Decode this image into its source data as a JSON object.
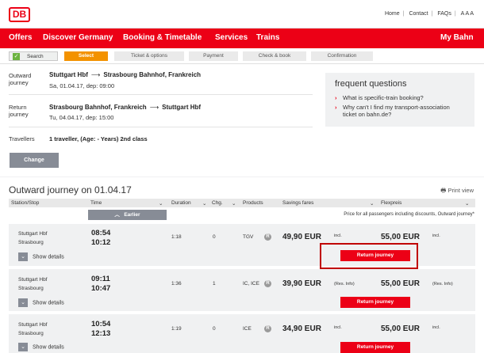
{
  "brand": {
    "logo": "DB",
    "primary_color": "#ec0016",
    "accent_color": "#f39200"
  },
  "top_links": {
    "home": "Home",
    "contact": "Contact",
    "faqs": "FAQs",
    "font_size": "A A A"
  },
  "nav": {
    "offers": "Offers",
    "discover": "Discover Germany",
    "booking": "Booking & Timetable",
    "services": "Services",
    "trains": "Trains",
    "mybahn": "My Bahn"
  },
  "steps": [
    {
      "label": "Search",
      "state": "done"
    },
    {
      "label": "Select",
      "state": "active"
    },
    {
      "label": "Ticket & options",
      "state": "pending"
    },
    {
      "label": "Payment",
      "state": "pending"
    },
    {
      "label": "Check & book",
      "state": "pending"
    },
    {
      "label": "Confirmation",
      "state": "pending"
    }
  ],
  "summary": {
    "outward_label": "Outward journey",
    "outward_from": "Stuttgart Hbf",
    "outward_to": "Strasbourg Bahnhof, Frankreich",
    "outward_date": "Sa, 01.04.17, dep: 09:00",
    "return_label": "Return journey",
    "return_from": "Strasbourg Bahnhof, Frankreich",
    "return_to": "Stuttgart Hbf",
    "return_date": "Tu, 04.04.17, dep: 15:00",
    "travellers_label": "Travellers",
    "travellers_value": "1 traveller, (Age: - Years) 2nd class",
    "change_button": "Change"
  },
  "faq": {
    "title": "frequent questions",
    "q1": "What is specific-train booking?",
    "q2": "Why can't I find my transport-association ticket on bahn.de?"
  },
  "results": {
    "heading": "Outward journey on 01.04.17",
    "print_view": "Print view",
    "columns": {
      "station": "Station/Stop",
      "time": "Time",
      "duration": "Duration",
      "changes": "Chg.",
      "products": "Products",
      "savings": "Savings fares",
      "flex": "Flexpreis"
    },
    "earlier": "Earlier",
    "price_note": "Price for all passengers including discounts, Outward journey*",
    "show_details": "Show details",
    "return_button": "Return journey",
    "incl": "incl.",
    "res_info": "(Res. Info)",
    "connections": [
      {
        "from": "Stuttgart Hbf",
        "to": "Strasbourg",
        "dep": "08:54",
        "arr": "10:12",
        "duration": "1:18",
        "changes": "0",
        "products": "TGV",
        "savings": "49,90 EUR",
        "flex": "55,00 EUR"
      },
      {
        "from": "Stuttgart Hbf",
        "to": "Strasbourg",
        "dep": "09:11",
        "arr": "10:47",
        "duration": "1:36",
        "changes": "1",
        "products": "IC, ICE",
        "savings": "39,90 EUR",
        "flex": "55,00 EUR"
      },
      {
        "from": "Stuttgart Hbf",
        "to": "Strasbourg",
        "dep": "10:54",
        "arr": "12:13",
        "duration": "1:19",
        "changes": "0",
        "products": "ICE",
        "savings": "34,90 EUR",
        "flex": "55,00 EUR"
      }
    ]
  }
}
